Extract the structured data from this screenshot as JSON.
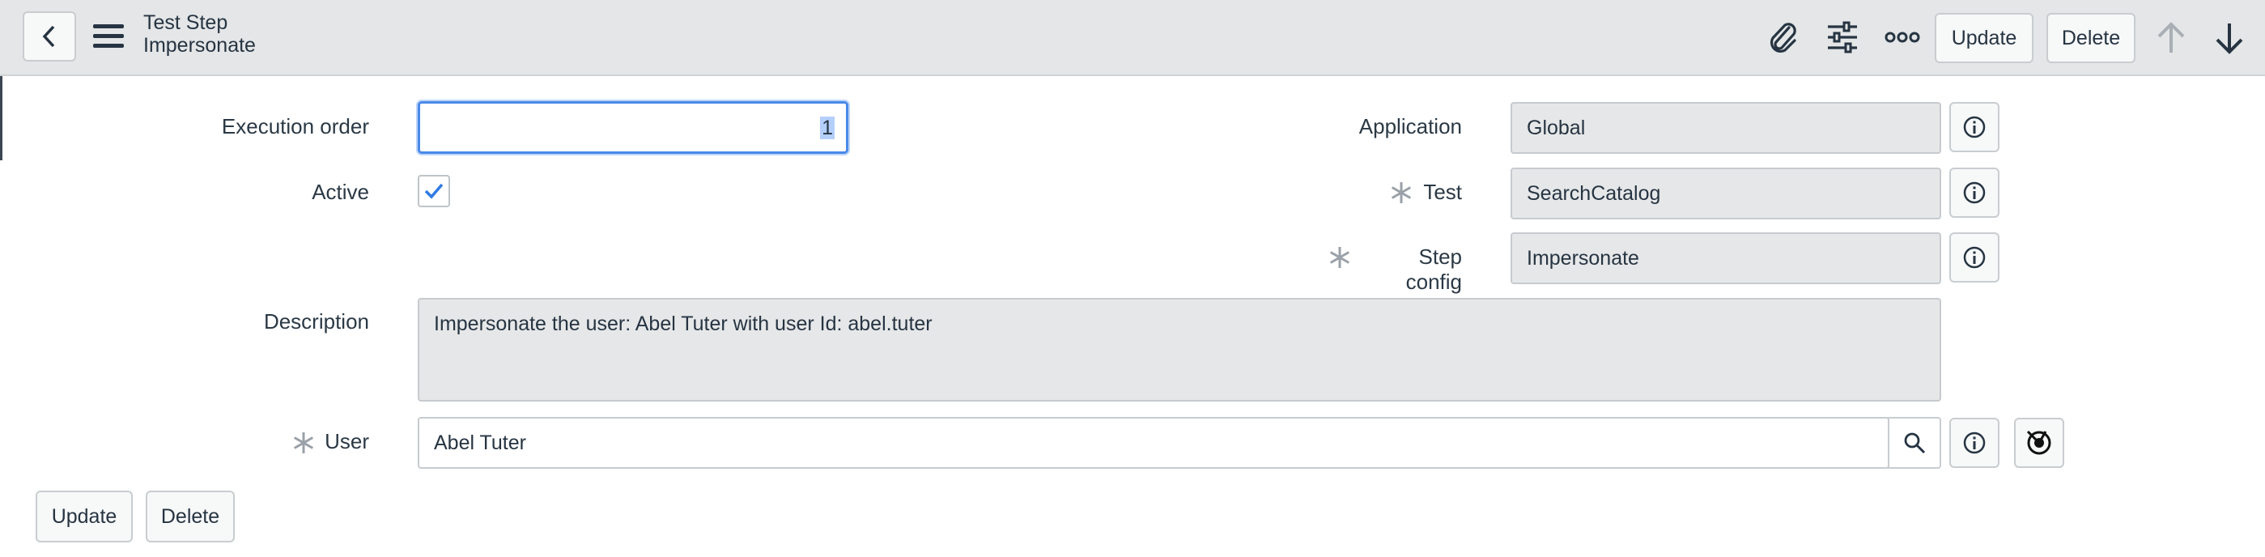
{
  "header": {
    "title_line1": "Test Step",
    "title_line2": "Impersonate",
    "update_label": "Update",
    "delete_label": "Delete"
  },
  "form": {
    "execution_order": {
      "label": "Execution order",
      "value": "1"
    },
    "active": {
      "label": "Active",
      "checked": true
    },
    "description": {
      "label": "Description",
      "value": "Impersonate the user: Abel Tuter with user Id: abel.tuter"
    },
    "user": {
      "label": "User",
      "value": "Abel Tuter"
    },
    "application": {
      "label": "Application",
      "value": "Global"
    },
    "test": {
      "label": "Test",
      "value": "SearchCatalog"
    },
    "step_config": {
      "label": "Step config",
      "value": "Impersonate"
    }
  },
  "footer": {
    "update_label": "Update",
    "delete_label": "Delete"
  },
  "icons": {
    "back": "chevron-left-icon",
    "menu": "hamburger-menu-icon",
    "attachment": "paperclip-icon",
    "personalize": "sliders-icon",
    "more": "more-options-icon",
    "up": "arrow-up-icon",
    "down": "arrow-down-icon",
    "info": "info-icon",
    "search": "search-icon",
    "preview": "reference-preview-icon",
    "required": "asterisk-icon",
    "check": "checkmark-icon"
  },
  "colors": {
    "focus": "#4a89e8",
    "header_bg": "#e4e6e7",
    "readonly_bg": "#e6e7e8"
  }
}
